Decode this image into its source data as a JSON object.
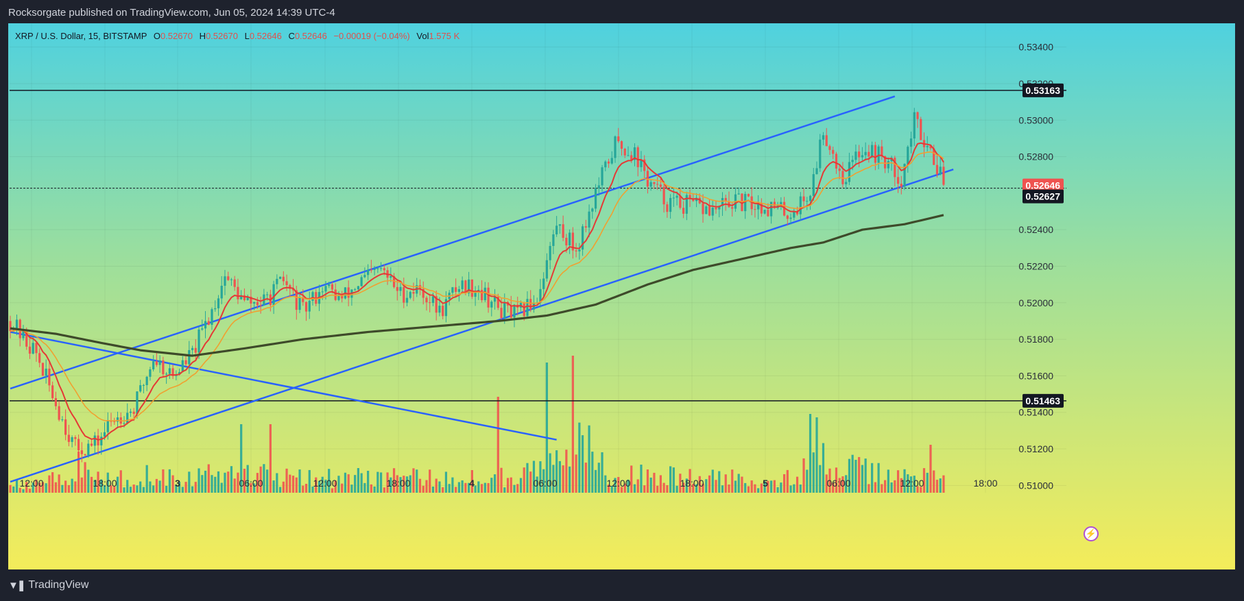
{
  "header": {
    "publisher": "Rocksorgate published on TradingView.com, Jun 05, 2024 14:39 UTC-4"
  },
  "legend": {
    "symbol": "XRP / U.S. Dollar, 15, BITSTAMP",
    "o_label": "O",
    "o": "0.52670",
    "h_label": "H",
    "h": "0.52670",
    "l_label": "L",
    "l": "0.52646",
    "c_label": "C",
    "c": "0.52646",
    "change": "−0.00019 (−0.04%)",
    "vol_label": "Vol",
    "vol": "1.575 K"
  },
  "footer": {
    "brand": "TradingView"
  },
  "chart_data": {
    "type": "candlestick",
    "colors": {
      "up": "#26a69a",
      "down": "#ef5350",
      "ema_fast": "#e53935",
      "ema_mid": "#f0a030",
      "ema_slow": "#3e4a2a",
      "trendline": "#2962ff",
      "background_top": "#4fd1df",
      "background_bottom": "#f4ec5a"
    },
    "y_axis": {
      "ylim": [
        0.5096,
        0.5353
      ],
      "ticks": [
        "0.53400",
        "0.53000",
        "0.52800",
        "0.52400",
        "0.52200",
        "0.52000",
        "0.51800",
        "0.51600",
        "0.51400",
        "0.51200",
        "0.51000"
      ],
      "partial_tick": "0.53200"
    },
    "x_axis": {
      "ticks": [
        "12:00",
        "18:00",
        "3",
        "06:00",
        "12:00",
        "18:00",
        "4",
        "06:00",
        "12:00",
        "18:00",
        "5",
        "06:00",
        "12:00",
        "18:00"
      ],
      "bold_ticks": [
        "3",
        "4",
        "5"
      ]
    },
    "horizontal_levels": [
      {
        "label": "0.53163",
        "value": 0.53163
      },
      {
        "label": "0.51463",
        "value": 0.51463
      },
      {
        "label": "0.52627",
        "value": 0.52627
      }
    ],
    "last_price": {
      "label": "0.52646",
      "value": 0.52646
    },
    "anchors": [
      [
        0,
        0.519
      ],
      [
        8,
        0.5172
      ],
      [
        14,
        0.5145
      ],
      [
        20,
        0.512
      ],
      [
        26,
        0.5122
      ],
      [
        32,
        0.5137
      ],
      [
        38,
        0.5142
      ],
      [
        44,
        0.517
      ],
      [
        50,
        0.516
      ],
      [
        56,
        0.5172
      ],
      [
        62,
        0.5196
      ],
      [
        66,
        0.5215
      ],
      [
        72,
        0.52
      ],
      [
        78,
        0.52
      ],
      [
        84,
        0.5212
      ],
      [
        90,
        0.5195
      ],
      [
        96,
        0.5209
      ],
      [
        102,
        0.5202
      ],
      [
        108,
        0.5212
      ],
      [
        114,
        0.5218
      ],
      [
        120,
        0.5205
      ],
      [
        126,
        0.5208
      ],
      [
        132,
        0.5195
      ],
      [
        138,
        0.521
      ],
      [
        144,
        0.5208
      ],
      [
        150,
        0.5197
      ],
      [
        156,
        0.5193
      ],
      [
        162,
        0.5203
      ],
      [
        168,
        0.5243
      ],
      [
        174,
        0.5229
      ],
      [
        180,
        0.526
      ],
      [
        186,
        0.5287
      ],
      [
        192,
        0.5282
      ],
      [
        196,
        0.5267
      ],
      [
        202,
        0.5255
      ],
      [
        210,
        0.5253
      ],
      [
        216,
        0.525
      ],
      [
        222,
        0.5255
      ],
      [
        228,
        0.5254
      ],
      [
        234,
        0.5252
      ],
      [
        240,
        0.5249
      ],
      [
        246,
        0.526
      ],
      [
        250,
        0.5295
      ],
      [
        256,
        0.5268
      ],
      [
        262,
        0.5285
      ],
      [
        268,
        0.528
      ],
      [
        274,
        0.5268
      ],
      [
        278,
        0.53
      ],
      [
        284,
        0.528
      ],
      [
        287,
        0.52646
      ]
    ],
    "volume_anchors": [
      [
        0,
        12
      ],
      [
        10,
        30
      ],
      [
        20,
        40
      ],
      [
        30,
        25
      ],
      [
        45,
        35
      ],
      [
        60,
        30
      ],
      [
        70,
        45
      ],
      [
        80,
        30
      ],
      [
        90,
        35
      ],
      [
        100,
        25
      ],
      [
        115,
        30
      ],
      [
        130,
        25
      ],
      [
        150,
        30
      ],
      [
        160,
        35
      ],
      [
        165,
        70
      ],
      [
        170,
        40
      ],
      [
        176,
        90
      ],
      [
        185,
        35
      ],
      [
        200,
        30
      ],
      [
        220,
        25
      ],
      [
        240,
        28
      ],
      [
        250,
        55
      ],
      [
        260,
        40
      ],
      [
        270,
        30
      ],
      [
        280,
        30
      ],
      [
        287,
        20
      ]
    ],
    "volume_spikes": [
      [
        21,
        60
      ],
      [
        71,
        100
      ],
      [
        80,
        100
      ],
      [
        150,
        140
      ],
      [
        165,
        190
      ],
      [
        173,
        200
      ],
      [
        246,
        115
      ],
      [
        248,
        110
      ],
      [
        283,
        70
      ]
    ],
    "trendlines": [
      {
        "name": "channel-upper",
        "from": [
          0,
          0.5153
        ],
        "to": [
          272,
          0.5313
        ]
      },
      {
        "name": "channel-lower",
        "from": [
          0,
          0.5102
        ],
        "to": [
          290,
          0.5273
        ]
      },
      {
        "name": "descending-line",
        "from": [
          0,
          0.5184
        ],
        "to": [
          168,
          0.5125
        ]
      }
    ],
    "ema_slow_anchors": [
      [
        0,
        0.5186
      ],
      [
        14,
        0.5183
      ],
      [
        28,
        0.5178
      ],
      [
        40,
        0.5174
      ],
      [
        56,
        0.5171
      ],
      [
        72,
        0.5175
      ],
      [
        90,
        0.518
      ],
      [
        110,
        0.5184
      ],
      [
        130,
        0.5187
      ],
      [
        150,
        0.519
      ],
      [
        165,
        0.5193
      ],
      [
        180,
        0.5199
      ],
      [
        196,
        0.521
      ],
      [
        210,
        0.5218
      ],
      [
        225,
        0.5224
      ],
      [
        240,
        0.523
      ],
      [
        250,
        0.5233
      ],
      [
        262,
        0.524
      ],
      [
        275,
        0.5243
      ],
      [
        287,
        0.5248
      ]
    ]
  }
}
